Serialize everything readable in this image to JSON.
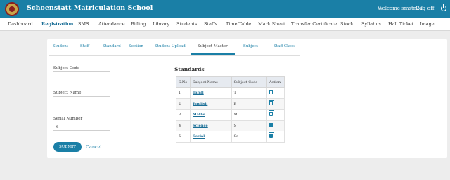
{
  "header": {
    "school_name": "Schoenstatt Matriculation School",
    "welcome": "Welcome smstn22",
    "logoff": "Log off"
  },
  "nav": [
    "Dashboard",
    "Registration",
    "SMS",
    "Attendance",
    "Billing",
    "Library",
    "Students",
    "Staffs",
    "Time Table",
    "Mark Sheet",
    "Transfer Certificate",
    "Stock",
    "Syllabus",
    "Hall Ticket",
    "Image"
  ],
  "nav_active": "Registration",
  "tabs": [
    "Student",
    "Staff",
    "Standard",
    "Section",
    "Student Upload",
    "Subject Master",
    "Subject",
    "Staff Class"
  ],
  "tab_active": "Subject Master",
  "form": {
    "subject_code_label": "Subject Code",
    "subject_code_value": "",
    "subject_name_label": "Subject Name",
    "subject_name_value": "",
    "serial_number_label": "Serial Number",
    "serial_number_value": "6",
    "submit": "SUBMIT",
    "cancel": "Cancel"
  },
  "standards": {
    "title": "Standards",
    "columns": [
      "S.No",
      "Subject Name",
      "Subject Code",
      "Action"
    ],
    "rows": [
      {
        "sno": "1",
        "name": "Tamil",
        "code": "T"
      },
      {
        "sno": "2",
        "name": "English",
        "code": "E"
      },
      {
        "sno": "3",
        "name": "Maths",
        "code": "M"
      },
      {
        "sno": "4",
        "name": "Science",
        "code": "S"
      },
      {
        "sno": "5",
        "name": "Social",
        "code": "So"
      }
    ]
  },
  "colors": {
    "accent": "#1a7fa6",
    "background": "#ededed"
  }
}
